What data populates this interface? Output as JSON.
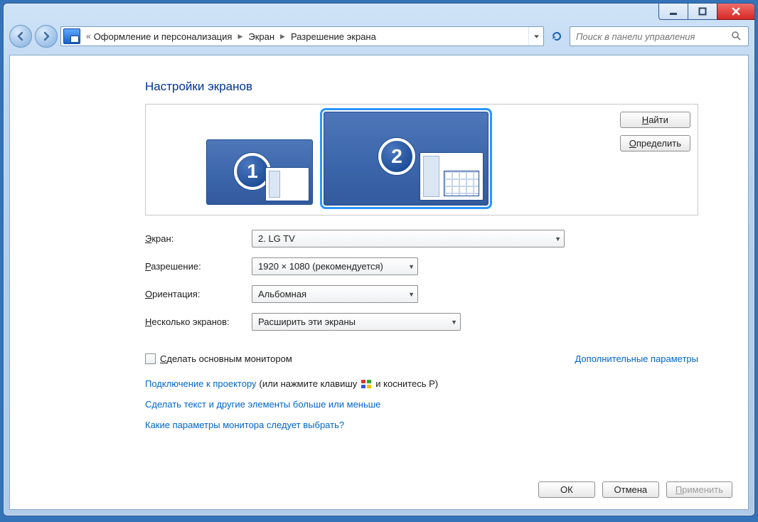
{
  "breadcrumb": {
    "level1": "Оформление и персонализация",
    "level2": "Экран",
    "level3": "Разрешение экрана"
  },
  "search": {
    "placeholder": "Поиск в панели управления"
  },
  "page_title": "Настройки экранов",
  "preview": {
    "monitor1_number": "1",
    "monitor2_number": "2",
    "find_btn": "Найти",
    "find_accel": "Н",
    "identify_btn": "Определить",
    "identify_accel": "О"
  },
  "form": {
    "display_label": "Экран:",
    "display_accel": "Э",
    "display_value": "2. LG TV",
    "resolution_label": "Разрешение:",
    "resolution_accel": "Р",
    "resolution_value": "1920 × 1080 (рекомендуется)",
    "orientation_label": "Ориентация:",
    "orientation_accel": "О",
    "orientation_value": "Альбомная",
    "multi_label": "Несколько экранов:",
    "multi_accel": "Н",
    "multi_value": "Расширить эти экраны"
  },
  "checkbox": {
    "label": "Сделать основным монитором",
    "accel": "С",
    "advanced_link": "Дополнительные параметры"
  },
  "help": {
    "projector_link": "Подключение к проектору",
    "projector_suffix1": " (или нажмите клавишу ",
    "projector_suffix2": " и коснитесь P)",
    "textsize_link": "Сделать текст и другие элементы больше или меньше",
    "which_link": "Какие параметры монитора следует выбрать?"
  },
  "actions": {
    "ok": "ОК",
    "cancel": "Отмена",
    "apply": "Применить",
    "apply_accel": "П"
  }
}
